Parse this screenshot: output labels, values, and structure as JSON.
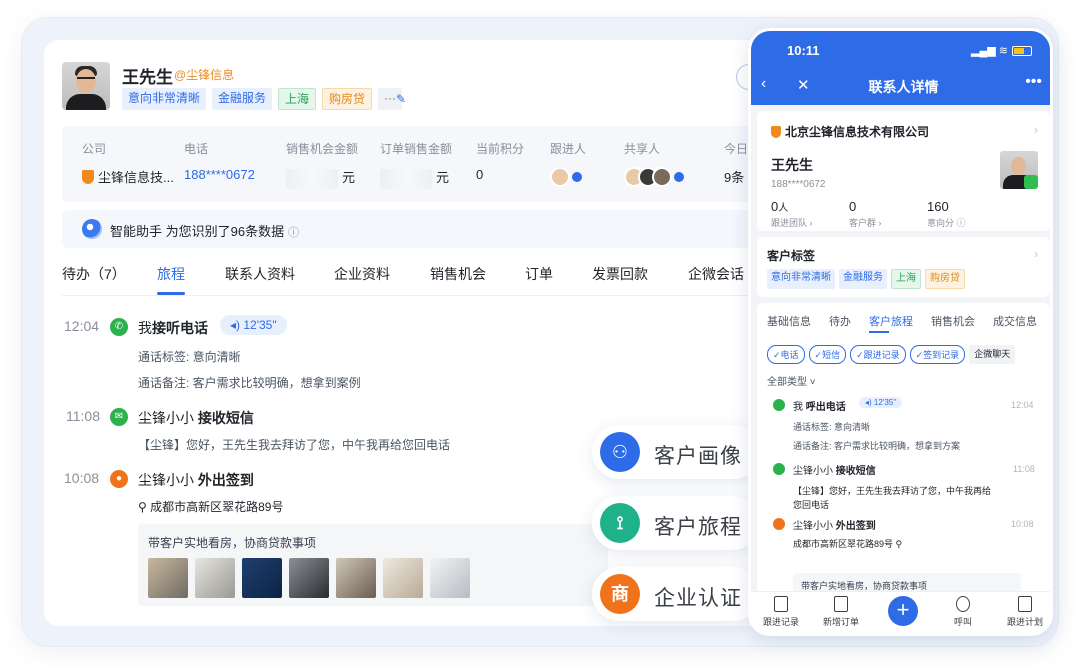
{
  "contact": {
    "name": "王先生",
    "company_handle": "@尘锋信息",
    "tags": [
      {
        "label": "意向非常清晰",
        "style": "blue"
      },
      {
        "label": "金融服务",
        "style": "blue"
      },
      {
        "label": "上海",
        "style": "green"
      },
      {
        "label": "购房贷",
        "style": "orange"
      },
      {
        "label": "···",
        "style": "more"
      }
    ]
  },
  "info": {
    "columns": [
      {
        "label": "公司",
        "value": "尘锋信息技..."
      },
      {
        "label": "电话",
        "value": "188****0672"
      },
      {
        "label": "销售机会金额",
        "value": "元"
      },
      {
        "label": "订单销售金额",
        "value": "元"
      },
      {
        "label": "当前积分",
        "value": "0"
      },
      {
        "label": "跟进人",
        "value": ""
      },
      {
        "label": "共享人",
        "value": ""
      },
      {
        "label": "今日",
        "value": "9条"
      }
    ]
  },
  "assistant": {
    "name": "智能助手",
    "text": "为您识别了96条数据"
  },
  "tabs": [
    "待办（7）",
    "旅程",
    "联系人资料",
    "企业资料",
    "销售机会",
    "订单",
    "发票回款",
    "企微会话"
  ],
  "timeline": {
    "items": [
      {
        "time": "12:04",
        "actor": "我",
        "action": "接听电话",
        "duration": "12'35\"",
        "sub1": "通话标签: 意向清晰",
        "sub2": "通话备注: 客户需求比较明确，想拿到案例"
      },
      {
        "time": "11:08",
        "actor": "尘锋小小",
        "action": "接收短信",
        "sub1": "【尘锋】您好，王先生我去拜访了您，中午我再给您回电话"
      },
      {
        "time": "10:08",
        "actor": "尘锋小小",
        "action": "外出签到",
        "address": "成都市高新区翠花路89号",
        "note": "带客户实地看房，协商贷款事项"
      }
    ]
  },
  "features": [
    {
      "label": "客户画像",
      "icon": "user-portrait-icon",
      "color": "#2e6be6"
    },
    {
      "label": "客户旅程",
      "icon": "journey-icon",
      "color": "#1fb28a"
    },
    {
      "label": "企业认证",
      "icon": "enterprise-cert-icon",
      "glyph": "商",
      "color": "#f0731c"
    }
  ],
  "phone": {
    "time": "10:11",
    "title": "联系人详情",
    "company": "北京尘锋信息技术有限公司",
    "name": "王先生",
    "mobile": "188****0672",
    "stats": [
      {
        "value": "0",
        "unit": "人",
        "label": "跟进团队 ›"
      },
      {
        "value": "0",
        "unit": "",
        "label": "客户群 ›"
      },
      {
        "value": "160",
        "unit": "",
        "label": "意向分 ⓘ"
      }
    ],
    "tag_section_title": "客户标签",
    "tags": [
      {
        "label": "意向非常清晰",
        "style": "blue"
      },
      {
        "label": "金融服务",
        "style": "blue"
      },
      {
        "label": "上海",
        "style": "green"
      },
      {
        "label": "购房贷",
        "style": "orange"
      }
    ],
    "tabs": [
      "基础信息",
      "待办",
      "客户旅程",
      "销售机会",
      "成交信息"
    ],
    "chips": [
      "✓电话",
      "✓短信",
      "✓跟进记录",
      "✓签到记录",
      "企微聊天"
    ],
    "filter": "全部类型 ˅",
    "events": [
      {
        "actor": "我",
        "action": "呼出电话",
        "duration": "12'35\"",
        "time": "12:04",
        "sub1": "通话标签:  意向清晰",
        "sub2": "通话备注: 客户需求比较明确，想拿到方案"
      },
      {
        "actor": "尘锋小小",
        "action": "接收短信",
        "time": "11:08",
        "sub1": "【尘锋】您好，王先生我去拜访了您，中午我再给",
        "sub2": "您回电话"
      },
      {
        "actor": "尘锋小小",
        "action": "外出签到",
        "time": "10:08",
        "address": "成都市高新区翠花路89号",
        "note": "带客户实地看房，协商贷款事项"
      }
    ],
    "bottom_bar": [
      "跟进记录",
      "新增订单",
      "呼叫",
      "跟进计划"
    ]
  }
}
